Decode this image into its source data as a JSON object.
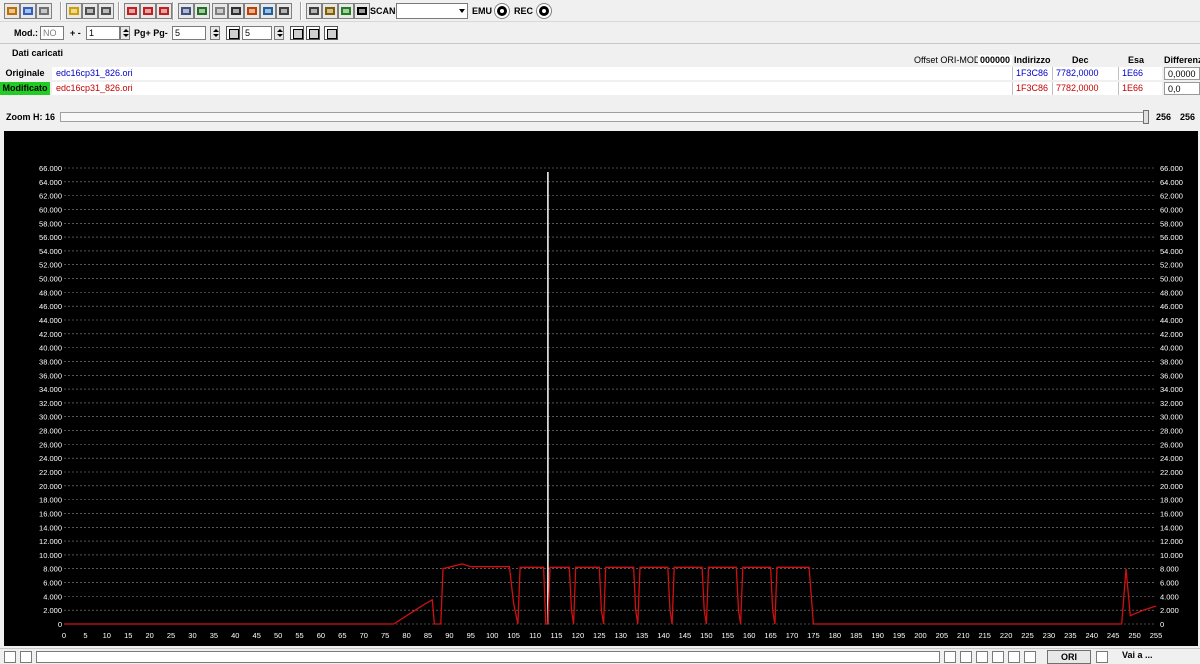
{
  "toolbar": {
    "scan_label": "SCAN",
    "emu_label": "EMU",
    "rec_label": "REC"
  },
  "controls": {
    "mod_label": "Mod.:",
    "mod_value": "NO",
    "step_label": "+ -",
    "step_value": "1",
    "page_label": "Pg+ Pg-",
    "page_value": "5",
    "extra_value": "5"
  },
  "data_panel": {
    "title": "Dati caricati",
    "offset_label": "Offset ORI-MOD",
    "offset_value": "000000",
    "headers": {
      "address": "Indirizzo",
      "dec": "Dec",
      "hex": "Esa",
      "diff": "Differenza"
    },
    "original": {
      "label": "Originale",
      "file": "edc16cp31_826.ori",
      "address": "1F3C86",
      "dec": "7782,0000",
      "hex": "1E66",
      "diff": "0,0000"
    },
    "modified": {
      "label": "Modificato",
      "file": "edc16cp31_826.ori",
      "address": "1F3C86",
      "dec": "7782,0000",
      "hex": "1E66",
      "diff": "0,0"
    }
  },
  "zoom": {
    "label": "Zoom H: 16",
    "value1": "256",
    "value2": "256"
  },
  "status": {
    "ori_label": "ORI",
    "goto_label": "Vai a ..."
  },
  "colors": {
    "chart_bg": "#000000",
    "grid": "#8a8a8a",
    "line": "#d01010",
    "cursor": "#ffffff",
    "modified_bg": "#22cc22"
  },
  "chart_data": {
    "type": "line",
    "xlim": [
      0,
      255
    ],
    "ylim": [
      0,
      66000
    ],
    "x_ticks": [
      0,
      5,
      10,
      15,
      20,
      25,
      30,
      35,
      40,
      45,
      50,
      55,
      60,
      65,
      70,
      75,
      80,
      85,
      90,
      95,
      100,
      105,
      110,
      115,
      120,
      125,
      130,
      135,
      140,
      145,
      150,
      155,
      160,
      165,
      170,
      175,
      180,
      185,
      190,
      195,
      200,
      205,
      210,
      215,
      220,
      225,
      230,
      235,
      240,
      245,
      250,
      255
    ],
    "y_ticks": [
      "0",
      "2.000",
      "4.000",
      "6.000",
      "8.000",
      "10.000",
      "12.000",
      "14.000",
      "16.000",
      "18.000",
      "20.000",
      "22.000",
      "24.000",
      "26.000",
      "28.000",
      "30.000",
      "32.000",
      "34.000",
      "36.000",
      "38.000",
      "40.000",
      "42.000",
      "44.000",
      "46.000",
      "48.000",
      "50.000",
      "52.000",
      "54.000",
      "56.000",
      "58.000",
      "60.000",
      "62.000",
      "64.000",
      "66.000"
    ],
    "cursor_x": 113,
    "series": [
      {
        "points": [
          [
            0,
            0
          ],
          [
            77,
            0
          ],
          [
            80,
            1200
          ],
          [
            84,
            2800
          ],
          [
            86,
            3500
          ],
          [
            86.5,
            0
          ],
          [
            88,
            0
          ],
          [
            88.5,
            8000
          ],
          [
            93,
            8700
          ],
          [
            95,
            8300
          ],
          [
            104,
            8300
          ],
          [
            105,
            3000
          ],
          [
            106,
            0
          ],
          [
            106.5,
            8200
          ],
          [
            112,
            8200
          ],
          [
            112.5,
            0
          ],
          [
            113,
            0
          ],
          [
            113.5,
            8200
          ],
          [
            118,
            8200
          ],
          [
            118.5,
            2000
          ],
          [
            119,
            0
          ],
          [
            119.5,
            8200
          ],
          [
            125,
            8200
          ],
          [
            125.5,
            2000
          ],
          [
            126,
            0
          ],
          [
            126.5,
            8200
          ],
          [
            133,
            8200
          ],
          [
            133.5,
            2000
          ],
          [
            134,
            0
          ],
          [
            134.5,
            8200
          ],
          [
            141,
            8200
          ],
          [
            141.5,
            2000
          ],
          [
            142,
            0
          ],
          [
            142.5,
            8200
          ],
          [
            149,
            8200
          ],
          [
            149.5,
            2000
          ],
          [
            150,
            0
          ],
          [
            150.5,
            8200
          ],
          [
            157,
            8200
          ],
          [
            157.5,
            2000
          ],
          [
            158,
            0
          ],
          [
            158.5,
            8200
          ],
          [
            165,
            8200
          ],
          [
            165.5,
            2000
          ],
          [
            166,
            0
          ],
          [
            166.5,
            8200
          ],
          [
            174,
            8200
          ],
          [
            175,
            0
          ],
          [
            247,
            0
          ],
          [
            248,
            8000
          ],
          [
            249,
            1200
          ],
          [
            252,
            2000
          ],
          [
            255,
            2600
          ]
        ]
      }
    ]
  }
}
